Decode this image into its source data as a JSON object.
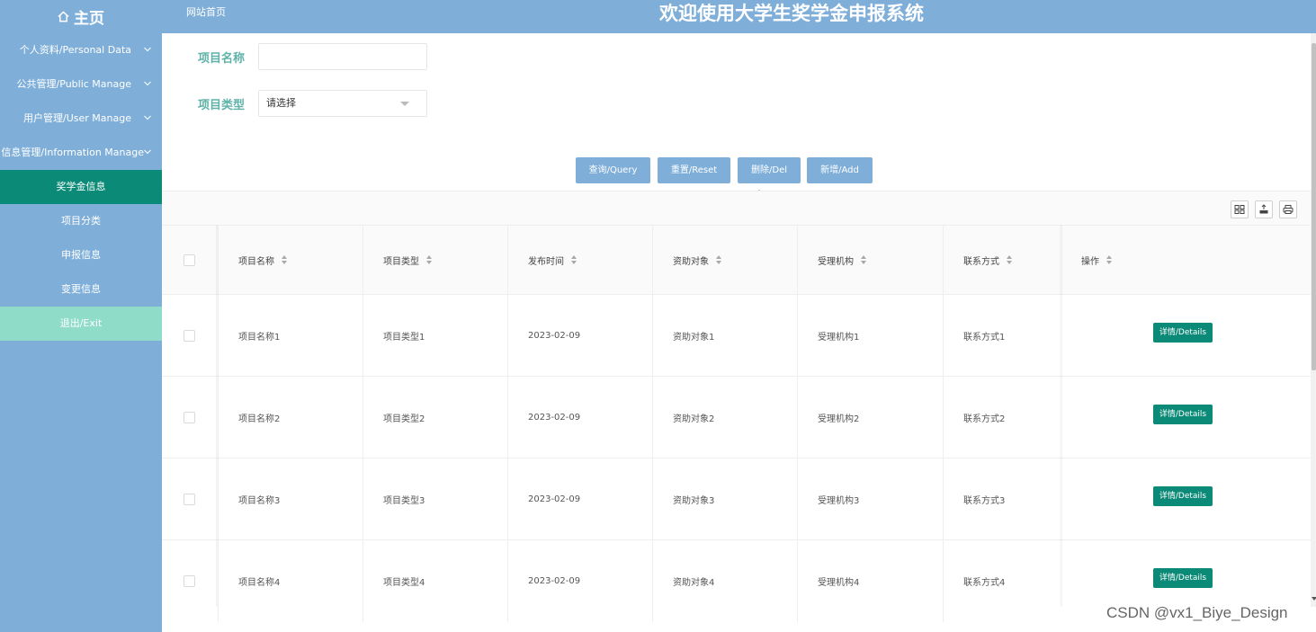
{
  "header": {
    "home_label": "主页",
    "site_link": "网站首页",
    "title": "欢迎使用大学生奖学金申报系统"
  },
  "sidebar": {
    "items": [
      {
        "label": "个人资料/Personal Data"
      },
      {
        "label": "公共管理/Public Manage"
      },
      {
        "label": "用户管理/User Manage"
      },
      {
        "label": "信息管理/Information Manage"
      }
    ],
    "subitems": [
      {
        "label": "奖学金信息"
      },
      {
        "label": "项目分类"
      },
      {
        "label": "申报信息"
      },
      {
        "label": "变更信息"
      }
    ],
    "exit_label": "退出/Exit"
  },
  "search": {
    "name_label": "项目名称",
    "name_value": "",
    "type_label": "项目类型",
    "type_placeholder": "请选择"
  },
  "buttons": {
    "query": "查询/Query",
    "reset": "重置/Reset",
    "delete": "删除/Del",
    "add": "新增/Add"
  },
  "table": {
    "columns": [
      "项目名称",
      "项目类型",
      "发布时间",
      "资助对象",
      "受理机构",
      "联系方式",
      "操作"
    ],
    "rows": [
      {
        "name": "项目名称1",
        "type": "项目类型1",
        "time": "2023-02-09",
        "target": "资助对象1",
        "org": "受理机构1",
        "contact": "联系方式1",
        "action": "详情/Details"
      },
      {
        "name": "项目名称2",
        "type": "项目类型2",
        "time": "2023-02-09",
        "target": "资助对象2",
        "org": "受理机构2",
        "contact": "联系方式2",
        "action": "详情/Details"
      },
      {
        "name": "项目名称3",
        "type": "项目类型3",
        "time": "2023-02-09",
        "target": "资助对象3",
        "org": "受理机构3",
        "contact": "联系方式3",
        "action": "详情/Details"
      },
      {
        "name": "项目名称4",
        "type": "项目类型4",
        "time": "2023-02-09",
        "target": "资助对象4",
        "org": "受理机构4",
        "contact": "联系方式4",
        "action": "详情/Details"
      }
    ]
  },
  "watermark": "CSDN @vx1_Biye_Design",
  "colors": {
    "header_bg": "#7fafd9",
    "active_item": "#0c8a78",
    "exit_item": "#8fdcc9",
    "label_color": "#5fb2a8",
    "details_button": "#0c8a78"
  },
  "icons": {
    "home": "home-icon",
    "chevron": "chevron-down-icon",
    "columns": "columns-icon",
    "export": "export-icon",
    "print": "print-icon"
  }
}
